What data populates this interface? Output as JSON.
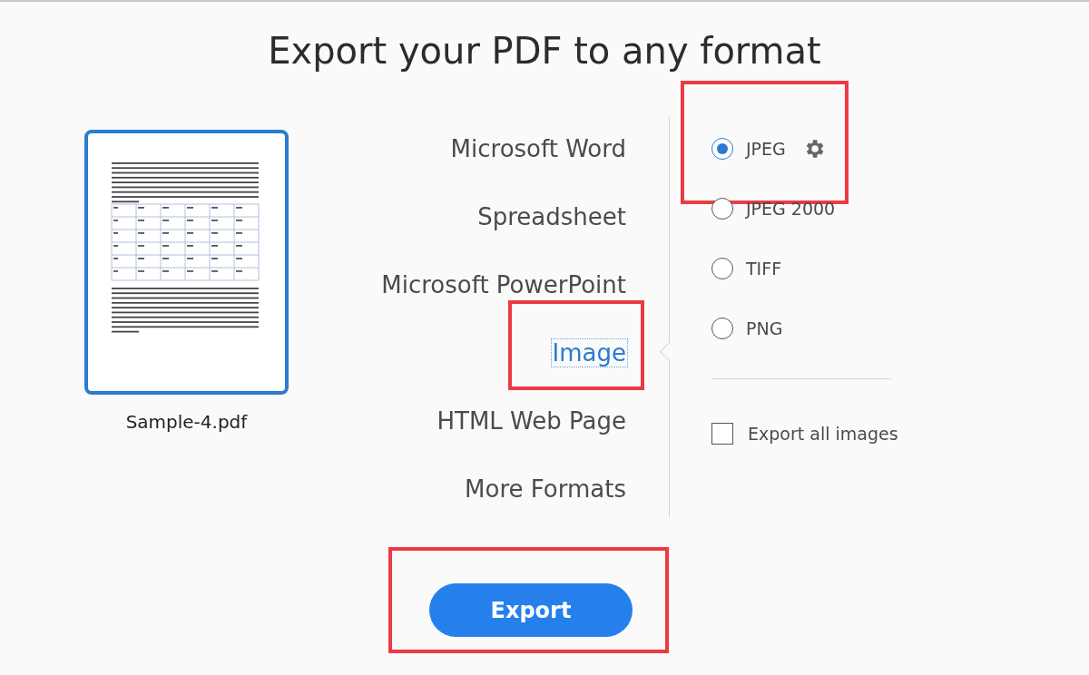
{
  "title": "Export your PDF to any format",
  "file": {
    "name": "Sample-4.pdf",
    "selected": true
  },
  "formats": [
    {
      "label": "Microsoft Word",
      "selected": false,
      "highlighted": false
    },
    {
      "label": "Spreadsheet",
      "selected": false,
      "highlighted": false
    },
    {
      "label": "Microsoft PowerPoint",
      "selected": false,
      "highlighted": false
    },
    {
      "label": "Image",
      "selected": true,
      "highlighted": true
    },
    {
      "label": "HTML Web Page",
      "selected": false,
      "highlighted": false
    },
    {
      "label": "More Formats",
      "selected": false,
      "highlighted": false
    }
  ],
  "options": [
    {
      "label": "JPEG",
      "selected": true,
      "settings": true,
      "highlighted": true
    },
    {
      "label": "JPEG 2000",
      "selected": false,
      "settings": false,
      "highlighted": false
    },
    {
      "label": "TIFF",
      "selected": false,
      "settings": false,
      "highlighted": false
    },
    {
      "label": "PNG",
      "selected": false,
      "settings": false,
      "highlighted": false
    }
  ],
  "export_all_images": {
    "label": "Export all images",
    "checked": false
  },
  "export_button": {
    "label": "Export",
    "highlighted": true
  }
}
